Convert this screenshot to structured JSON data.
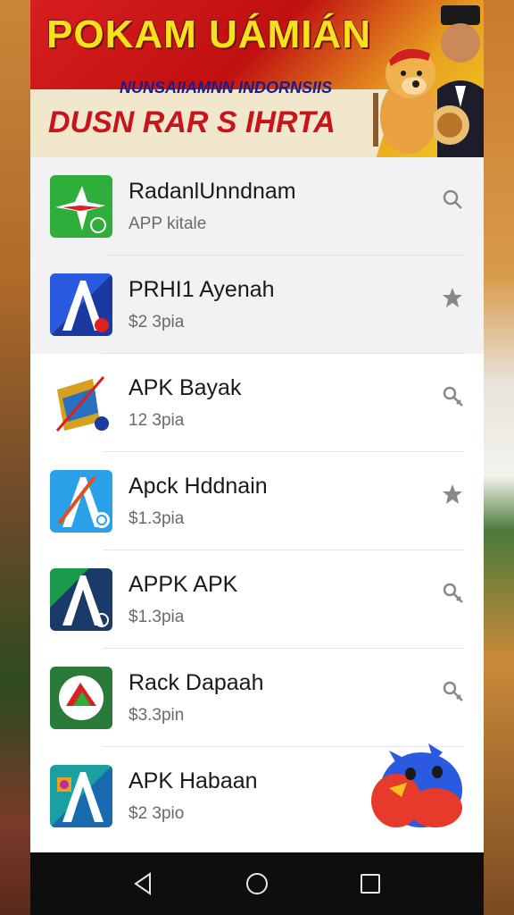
{
  "banner": {
    "title": "POKAM UÁMIÁN",
    "subtitle": "NUNSAIIAMNN INDORNSIIS",
    "tagline": "DUSN RAR S IHRTA"
  },
  "apps": [
    {
      "title": "RadanlUnndnam",
      "subtitle": "APP kitale",
      "icon": "star-app-icon",
      "action": "search-icon",
      "icon_color": "#2eae3a"
    },
    {
      "title": "PRHI1 Ayenah",
      "subtitle": "$2 3pia",
      "icon": "letter-a-app-icon",
      "action": "star-icon",
      "icon_color": "#1a3aa0"
    },
    {
      "title": "APK Bayak",
      "subtitle": "12 3pia",
      "icon": "flag-app-icon",
      "action": "settings-icon",
      "icon_color": "#d6a020"
    },
    {
      "title": "Apck Hddnain",
      "subtitle": "$1.3pia",
      "icon": "letter-a-app-icon",
      "action": "star-icon",
      "icon_color": "#2aa0e8"
    },
    {
      "title": "APPK APK",
      "subtitle": "$1.3pia",
      "icon": "letter-a-app-icon",
      "action": "settings-icon",
      "icon_color": "#1a7a4a"
    },
    {
      "title": "Rack Dapaah",
      "subtitle": "$3.3pin",
      "icon": "circle-app-icon",
      "action": "settings-icon",
      "icon_color": "#2a7a3a"
    },
    {
      "title": "APK Habaan",
      "subtitle": "$2 3pio",
      "icon": "letter-a-app-icon",
      "action": "bird-icon",
      "icon_color": "#1aa0a0"
    }
  ],
  "navbar": {
    "back": "back-icon",
    "home": "home-icon",
    "recents": "recents-icon"
  }
}
